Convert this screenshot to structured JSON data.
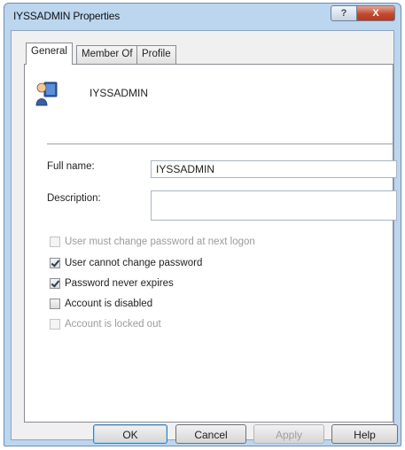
{
  "window": {
    "title": "IYSSADMIN Properties",
    "help_button": "?",
    "close_button": "X"
  },
  "tabs": [
    {
      "label": "General",
      "active": true
    },
    {
      "label": "Member Of",
      "active": false
    },
    {
      "label": "Profile",
      "active": false
    }
  ],
  "general": {
    "user_display_name": "IYSSADMIN",
    "full_name_label": "Full name:",
    "full_name_value": "IYSSADMIN",
    "description_label": "Description:",
    "description_value": ""
  },
  "options": [
    {
      "label": "User must change password at next logon",
      "checked": false,
      "enabled": false
    },
    {
      "label": "User cannot change password",
      "checked": true,
      "enabled": true
    },
    {
      "label": "Password never expires",
      "checked": true,
      "enabled": true
    },
    {
      "label": "Account is disabled",
      "checked": false,
      "enabled": true
    },
    {
      "label": "Account is locked out",
      "checked": false,
      "enabled": false
    }
  ],
  "buttons": {
    "ok": "OK",
    "cancel": "Cancel",
    "apply": "Apply",
    "help": "Help"
  },
  "icons": {
    "user": "user-icon",
    "help": "help-icon",
    "close": "close-icon"
  }
}
